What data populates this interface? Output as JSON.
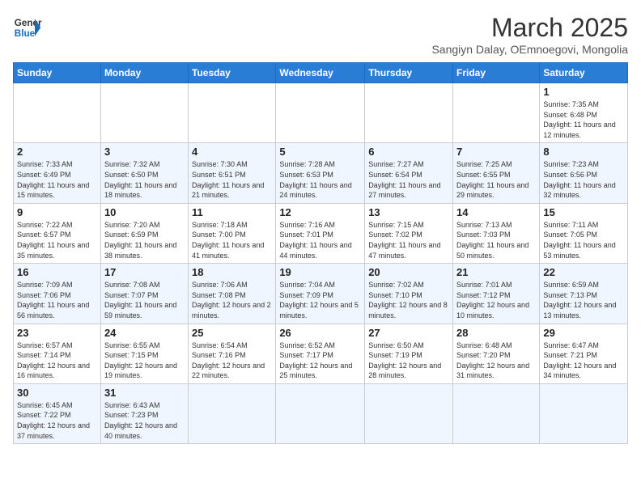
{
  "header": {
    "logo_general": "General",
    "logo_blue": "Blue",
    "month_year": "March 2025",
    "location": "Sangiyn Dalay, OEmnoegovi, Mongolia"
  },
  "weekdays": [
    "Sunday",
    "Monday",
    "Tuesday",
    "Wednesday",
    "Thursday",
    "Friday",
    "Saturday"
  ],
  "weeks": [
    [
      {
        "day": "",
        "info": ""
      },
      {
        "day": "",
        "info": ""
      },
      {
        "day": "",
        "info": ""
      },
      {
        "day": "",
        "info": ""
      },
      {
        "day": "",
        "info": ""
      },
      {
        "day": "",
        "info": ""
      },
      {
        "day": "1",
        "info": "Sunrise: 7:35 AM\nSunset: 6:48 PM\nDaylight: 11 hours and 12 minutes."
      }
    ],
    [
      {
        "day": "2",
        "info": "Sunrise: 7:33 AM\nSunset: 6:49 PM\nDaylight: 11 hours and 15 minutes."
      },
      {
        "day": "3",
        "info": "Sunrise: 7:32 AM\nSunset: 6:50 PM\nDaylight: 11 hours and 18 minutes."
      },
      {
        "day": "4",
        "info": "Sunrise: 7:30 AM\nSunset: 6:51 PM\nDaylight: 11 hours and 21 minutes."
      },
      {
        "day": "5",
        "info": "Sunrise: 7:28 AM\nSunset: 6:53 PM\nDaylight: 11 hours and 24 minutes."
      },
      {
        "day": "6",
        "info": "Sunrise: 7:27 AM\nSunset: 6:54 PM\nDaylight: 11 hours and 27 minutes."
      },
      {
        "day": "7",
        "info": "Sunrise: 7:25 AM\nSunset: 6:55 PM\nDaylight: 11 hours and 29 minutes."
      },
      {
        "day": "8",
        "info": "Sunrise: 7:23 AM\nSunset: 6:56 PM\nDaylight: 11 hours and 32 minutes."
      }
    ],
    [
      {
        "day": "9",
        "info": "Sunrise: 7:22 AM\nSunset: 6:57 PM\nDaylight: 11 hours and 35 minutes."
      },
      {
        "day": "10",
        "info": "Sunrise: 7:20 AM\nSunset: 6:59 PM\nDaylight: 11 hours and 38 minutes."
      },
      {
        "day": "11",
        "info": "Sunrise: 7:18 AM\nSunset: 7:00 PM\nDaylight: 11 hours and 41 minutes."
      },
      {
        "day": "12",
        "info": "Sunrise: 7:16 AM\nSunset: 7:01 PM\nDaylight: 11 hours and 44 minutes."
      },
      {
        "day": "13",
        "info": "Sunrise: 7:15 AM\nSunset: 7:02 PM\nDaylight: 11 hours and 47 minutes."
      },
      {
        "day": "14",
        "info": "Sunrise: 7:13 AM\nSunset: 7:03 PM\nDaylight: 11 hours and 50 minutes."
      },
      {
        "day": "15",
        "info": "Sunrise: 7:11 AM\nSunset: 7:05 PM\nDaylight: 11 hours and 53 minutes."
      }
    ],
    [
      {
        "day": "16",
        "info": "Sunrise: 7:09 AM\nSunset: 7:06 PM\nDaylight: 11 hours and 56 minutes."
      },
      {
        "day": "17",
        "info": "Sunrise: 7:08 AM\nSunset: 7:07 PM\nDaylight: 11 hours and 59 minutes."
      },
      {
        "day": "18",
        "info": "Sunrise: 7:06 AM\nSunset: 7:08 PM\nDaylight: 12 hours and 2 minutes."
      },
      {
        "day": "19",
        "info": "Sunrise: 7:04 AM\nSunset: 7:09 PM\nDaylight: 12 hours and 5 minutes."
      },
      {
        "day": "20",
        "info": "Sunrise: 7:02 AM\nSunset: 7:10 PM\nDaylight: 12 hours and 8 minutes."
      },
      {
        "day": "21",
        "info": "Sunrise: 7:01 AM\nSunset: 7:12 PM\nDaylight: 12 hours and 10 minutes."
      },
      {
        "day": "22",
        "info": "Sunrise: 6:59 AM\nSunset: 7:13 PM\nDaylight: 12 hours and 13 minutes."
      }
    ],
    [
      {
        "day": "23",
        "info": "Sunrise: 6:57 AM\nSunset: 7:14 PM\nDaylight: 12 hours and 16 minutes."
      },
      {
        "day": "24",
        "info": "Sunrise: 6:55 AM\nSunset: 7:15 PM\nDaylight: 12 hours and 19 minutes."
      },
      {
        "day": "25",
        "info": "Sunrise: 6:54 AM\nSunset: 7:16 PM\nDaylight: 12 hours and 22 minutes."
      },
      {
        "day": "26",
        "info": "Sunrise: 6:52 AM\nSunset: 7:17 PM\nDaylight: 12 hours and 25 minutes."
      },
      {
        "day": "27",
        "info": "Sunrise: 6:50 AM\nSunset: 7:19 PM\nDaylight: 12 hours and 28 minutes."
      },
      {
        "day": "28",
        "info": "Sunrise: 6:48 AM\nSunset: 7:20 PM\nDaylight: 12 hours and 31 minutes."
      },
      {
        "day": "29",
        "info": "Sunrise: 6:47 AM\nSunset: 7:21 PM\nDaylight: 12 hours and 34 minutes."
      }
    ],
    [
      {
        "day": "30",
        "info": "Sunrise: 6:45 AM\nSunset: 7:22 PM\nDaylight: 12 hours and 37 minutes."
      },
      {
        "day": "31",
        "info": "Sunrise: 6:43 AM\nSunset: 7:23 PM\nDaylight: 12 hours and 40 minutes."
      },
      {
        "day": "",
        "info": ""
      },
      {
        "day": "",
        "info": ""
      },
      {
        "day": "",
        "info": ""
      },
      {
        "day": "",
        "info": ""
      },
      {
        "day": "",
        "info": ""
      }
    ]
  ]
}
